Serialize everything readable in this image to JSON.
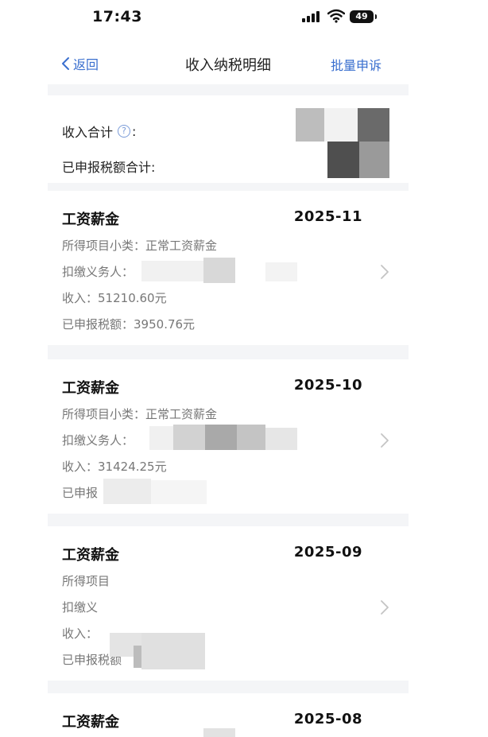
{
  "status_bar": {
    "time": "17:43",
    "battery": "49"
  },
  "nav": {
    "back_label": "返回",
    "title": "收入纳税明细",
    "right_action": "批量申诉"
  },
  "summary": {
    "income_total_label": "收入合计",
    "income_total_colon": ":",
    "tax_total_label": "已申报税额合计:"
  },
  "records": [
    {
      "title": "工资薪金",
      "date": "2025-11",
      "subcategory_label": "所得项目小类：",
      "subcategory_value": "正常工资薪金",
      "withholder_label": "扣缴义务人：",
      "income_label": "收入：",
      "income_value": "51210.60元",
      "tax_label": "已申报税额：",
      "tax_value": "3950.76元"
    },
    {
      "title": "工资薪金",
      "date": "2025-10",
      "subcategory_label": "所得项目小类：",
      "subcategory_value": "正常工资薪金",
      "withholder_label": "扣缴义务人：",
      "income_label": "收入：",
      "income_value": "31424.25元",
      "tax_label": "已申报"
    },
    {
      "title": "工资薪金",
      "date": "2025-09",
      "subcategory_label": "所得项目",
      "withholder_label": "扣缴义",
      "income_label": "收入：",
      "tax_label": "已申报税额"
    },
    {
      "title": "工资薪金",
      "date": "2025-08"
    }
  ],
  "colors": {
    "accent": "#3a6fcf",
    "page_bg": "#f4f5f7",
    "text_muted": "#777777"
  }
}
